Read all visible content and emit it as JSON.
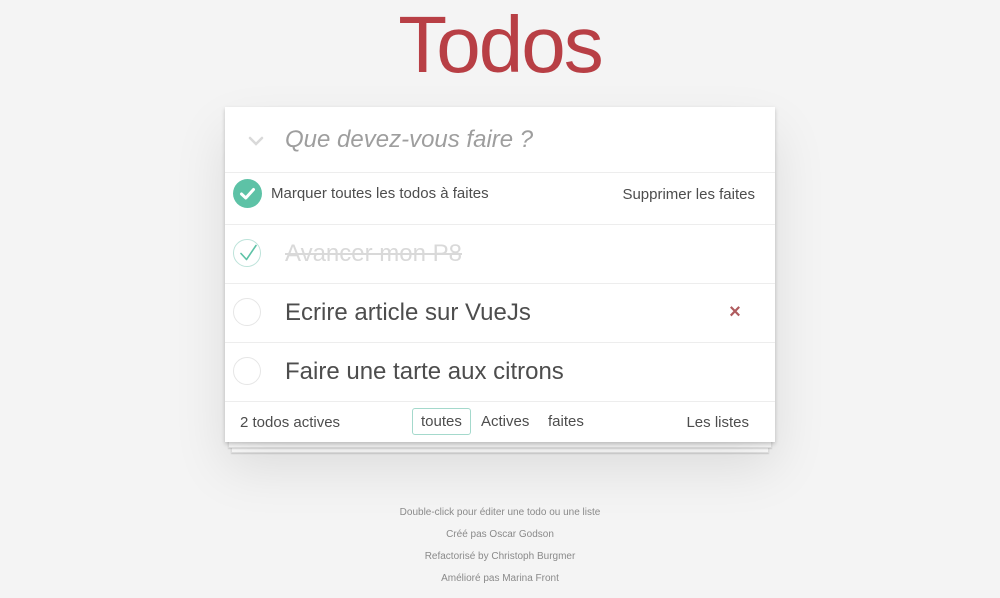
{
  "header": {
    "title": "Todos"
  },
  "new_todo": {
    "placeholder": "Que devez-vous faire ?",
    "value": ""
  },
  "toolbar": {
    "toggle_all_label": "Marquer toutes les todos à faites",
    "clear_completed_label": "Supprimer les faites"
  },
  "todos": [
    {
      "title": "Avancer mon P8",
      "completed": true
    },
    {
      "title": "Ecrire article sur VueJs",
      "completed": false
    },
    {
      "title": "Faire une tarte aux citrons",
      "completed": false
    }
  ],
  "footer": {
    "count_text": "2 todos actives",
    "filters": [
      "toutes",
      "Actives",
      "faites"
    ],
    "selected_filter": "toutes",
    "lists_link": "Les listes"
  },
  "info": [
    "Double-click pour éditer une todo ou une liste",
    "Créé pas Oscar Godson",
    "Refactorisé by Christoph Burgmer",
    "Amélioré pas Marina Front"
  ],
  "colors": {
    "accent": "#b83f45",
    "check": "#5dc2a6",
    "destroy": "#af5b5e"
  }
}
